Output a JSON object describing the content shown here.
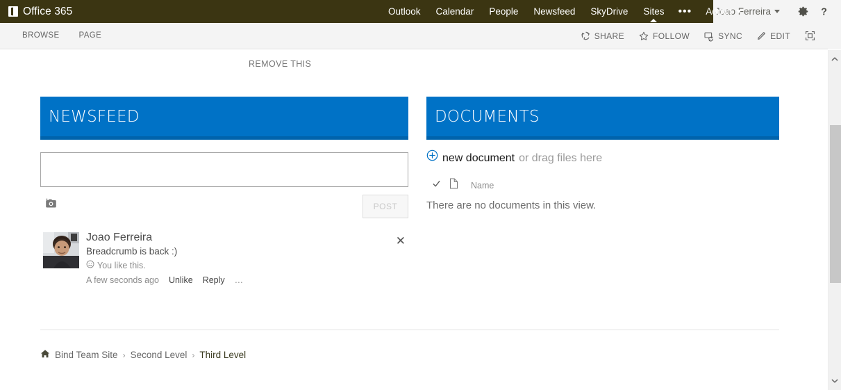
{
  "suite": {
    "brand": "Office 365",
    "brand_icon": "office-logo-icon",
    "nav": [
      {
        "label": "Outlook",
        "name": "outlook",
        "active": false
      },
      {
        "label": "Calendar",
        "name": "calendar",
        "active": false
      },
      {
        "label": "People",
        "name": "people",
        "active": false
      },
      {
        "label": "Newsfeed",
        "name": "newsfeed",
        "active": false
      },
      {
        "label": "SkyDrive",
        "name": "skydrive",
        "active": false
      },
      {
        "label": "Sites",
        "name": "sites",
        "active": true
      },
      {
        "label": "•••",
        "name": "more",
        "active": false
      },
      {
        "label": "Admin",
        "name": "admin",
        "active": false,
        "caret": true
      }
    ],
    "user_name": "Joao Ferreira",
    "settings_icon": "gear-icon",
    "help_icon": "help-question-icon"
  },
  "ribbon": {
    "tabs": [
      {
        "label": "BROWSE",
        "name": "browse"
      },
      {
        "label": "PAGE",
        "name": "page"
      }
    ],
    "actions": [
      {
        "label": "SHARE",
        "name": "share",
        "icon": "share-icon"
      },
      {
        "label": "FOLLOW",
        "name": "follow",
        "icon": "star-outline-icon"
      },
      {
        "label": "SYNC",
        "name": "sync",
        "icon": "sync-icon"
      },
      {
        "label": "EDIT",
        "name": "edit",
        "icon": "pencil-icon"
      }
    ],
    "focus_button": {
      "name": "focus-on-content",
      "icon": "focus-content-icon"
    }
  },
  "page": {
    "remove_this": "REMOVE THIS"
  },
  "newsfeed": {
    "title": "NEWSFEED",
    "input_value": "",
    "input_placeholder": "",
    "camera_icon": "camera-icon",
    "post_button": "POST",
    "post": {
      "author": "Joao Ferreira",
      "avatar_icon": "user-photo-avatar",
      "text": "Breadcrumb is back :)",
      "like_icon": "smiley-like-icon",
      "likes_text": "You like this.",
      "timestamp": "A few seconds ago",
      "unlike_label": "Unlike",
      "reply_label": "Reply",
      "more_label": "…",
      "close_icon": "close-icon"
    }
  },
  "documents": {
    "title": "DOCUMENTS",
    "new_document_icon": "plus-circle-icon",
    "new_document_label": "new document",
    "drag_files_label": "or drag files here",
    "check_icon": "checkmark-icon",
    "doc_type_icon": "document-icon",
    "name_column_header": "Name",
    "empty_message": "There are no documents in this view."
  },
  "breadcrumb": {
    "home_icon": "home-icon",
    "items": [
      {
        "label": "Bind Team Site",
        "current": false
      },
      {
        "label": "Second Level",
        "current": false
      },
      {
        "label": "Third Level",
        "current": true
      }
    ],
    "separator": "›"
  },
  "scrollbar": {
    "up_icon": "chevron-up-icon",
    "down_icon": "chevron-down-icon"
  },
  "colors": {
    "suite_bar": "#3b3512",
    "webpart_header": "#0072c6",
    "webpart_header_underline": "#0063ac",
    "ribbon_bg": "#f4f4f4"
  }
}
